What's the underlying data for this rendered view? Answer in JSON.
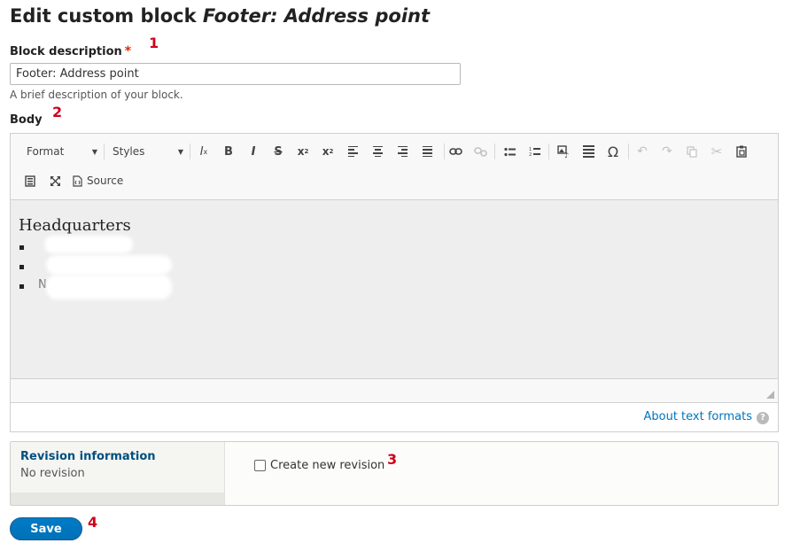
{
  "header": {
    "title_prefix": "Edit custom block",
    "title_name": "Footer: Address point"
  },
  "block_description": {
    "label": "Block description",
    "required_mark": "*",
    "value": "Footer: Address point",
    "help": "A brief description of your block."
  },
  "body": {
    "label": "Body",
    "toolbar": {
      "format_label": "Format",
      "styles_label": "Styles",
      "source_label": "Source",
      "icons": [
        "remove-format-icon",
        "bold-icon",
        "italic-icon",
        "strikethrough-icon",
        "superscript-icon",
        "subscript-icon",
        "align-left-icon",
        "align-center-icon",
        "align-right-icon",
        "justify-icon",
        "link-icon",
        "unlink-icon",
        "bulleted-list-icon",
        "numbered-list-icon",
        "image-icon",
        "horizontal-rule-icon",
        "special-character-icon",
        "undo-icon",
        "redo-icon",
        "copy-icon",
        "cut-icon",
        "paste-icon",
        "show-blocks-icon",
        "maximize-icon",
        "source-icon"
      ]
    },
    "content": {
      "heading": "Headquarters",
      "list_items": [
        "",
        "",
        "N"
      ]
    },
    "about_text_formats": "About text formats",
    "help_icon": "?"
  },
  "revision": {
    "title": "Revision information",
    "summary": "No revision",
    "checkbox_label": "Create new revision",
    "checked": false
  },
  "actions": {
    "save_label": "Save"
  },
  "annotations": [
    "1",
    "2",
    "3",
    "4"
  ],
  "colors": {
    "link": "#0074bd",
    "required": "#e62600",
    "annotation": "#d0021b",
    "save_button": "#0071b8"
  }
}
